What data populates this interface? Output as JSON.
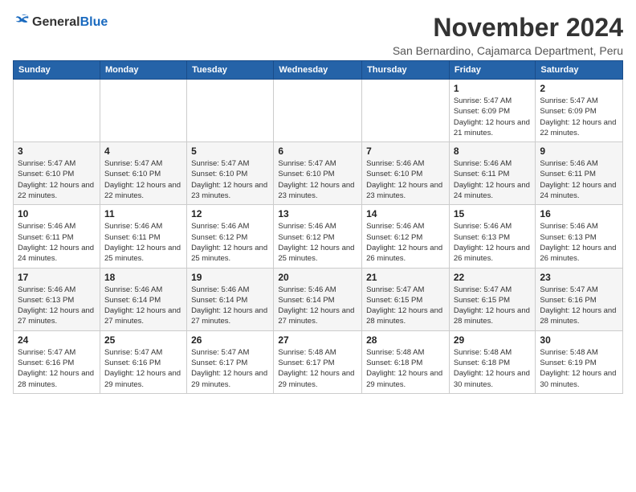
{
  "header": {
    "logo_general": "General",
    "logo_blue": "Blue",
    "month_title": "November 2024",
    "location": "San Bernardino, Cajamarca Department, Peru"
  },
  "weekdays": [
    "Sunday",
    "Monday",
    "Tuesday",
    "Wednesday",
    "Thursday",
    "Friday",
    "Saturday"
  ],
  "weeks": [
    [
      {
        "day": "",
        "info": ""
      },
      {
        "day": "",
        "info": ""
      },
      {
        "day": "",
        "info": ""
      },
      {
        "day": "",
        "info": ""
      },
      {
        "day": "",
        "info": ""
      },
      {
        "day": "1",
        "info": "Sunrise: 5:47 AM\nSunset: 6:09 PM\nDaylight: 12 hours and 21 minutes."
      },
      {
        "day": "2",
        "info": "Sunrise: 5:47 AM\nSunset: 6:09 PM\nDaylight: 12 hours and 22 minutes."
      }
    ],
    [
      {
        "day": "3",
        "info": "Sunrise: 5:47 AM\nSunset: 6:10 PM\nDaylight: 12 hours and 22 minutes."
      },
      {
        "day": "4",
        "info": "Sunrise: 5:47 AM\nSunset: 6:10 PM\nDaylight: 12 hours and 22 minutes."
      },
      {
        "day": "5",
        "info": "Sunrise: 5:47 AM\nSunset: 6:10 PM\nDaylight: 12 hours and 23 minutes."
      },
      {
        "day": "6",
        "info": "Sunrise: 5:47 AM\nSunset: 6:10 PM\nDaylight: 12 hours and 23 minutes."
      },
      {
        "day": "7",
        "info": "Sunrise: 5:46 AM\nSunset: 6:10 PM\nDaylight: 12 hours and 23 minutes."
      },
      {
        "day": "8",
        "info": "Sunrise: 5:46 AM\nSunset: 6:11 PM\nDaylight: 12 hours and 24 minutes."
      },
      {
        "day": "9",
        "info": "Sunrise: 5:46 AM\nSunset: 6:11 PM\nDaylight: 12 hours and 24 minutes."
      }
    ],
    [
      {
        "day": "10",
        "info": "Sunrise: 5:46 AM\nSunset: 6:11 PM\nDaylight: 12 hours and 24 minutes."
      },
      {
        "day": "11",
        "info": "Sunrise: 5:46 AM\nSunset: 6:11 PM\nDaylight: 12 hours and 25 minutes."
      },
      {
        "day": "12",
        "info": "Sunrise: 5:46 AM\nSunset: 6:12 PM\nDaylight: 12 hours and 25 minutes."
      },
      {
        "day": "13",
        "info": "Sunrise: 5:46 AM\nSunset: 6:12 PM\nDaylight: 12 hours and 25 minutes."
      },
      {
        "day": "14",
        "info": "Sunrise: 5:46 AM\nSunset: 6:12 PM\nDaylight: 12 hours and 26 minutes."
      },
      {
        "day": "15",
        "info": "Sunrise: 5:46 AM\nSunset: 6:13 PM\nDaylight: 12 hours and 26 minutes."
      },
      {
        "day": "16",
        "info": "Sunrise: 5:46 AM\nSunset: 6:13 PM\nDaylight: 12 hours and 26 minutes."
      }
    ],
    [
      {
        "day": "17",
        "info": "Sunrise: 5:46 AM\nSunset: 6:13 PM\nDaylight: 12 hours and 27 minutes."
      },
      {
        "day": "18",
        "info": "Sunrise: 5:46 AM\nSunset: 6:14 PM\nDaylight: 12 hours and 27 minutes."
      },
      {
        "day": "19",
        "info": "Sunrise: 5:46 AM\nSunset: 6:14 PM\nDaylight: 12 hours and 27 minutes."
      },
      {
        "day": "20",
        "info": "Sunrise: 5:46 AM\nSunset: 6:14 PM\nDaylight: 12 hours and 27 minutes."
      },
      {
        "day": "21",
        "info": "Sunrise: 5:47 AM\nSunset: 6:15 PM\nDaylight: 12 hours and 28 minutes."
      },
      {
        "day": "22",
        "info": "Sunrise: 5:47 AM\nSunset: 6:15 PM\nDaylight: 12 hours and 28 minutes."
      },
      {
        "day": "23",
        "info": "Sunrise: 5:47 AM\nSunset: 6:16 PM\nDaylight: 12 hours and 28 minutes."
      }
    ],
    [
      {
        "day": "24",
        "info": "Sunrise: 5:47 AM\nSunset: 6:16 PM\nDaylight: 12 hours and 28 minutes."
      },
      {
        "day": "25",
        "info": "Sunrise: 5:47 AM\nSunset: 6:16 PM\nDaylight: 12 hours and 29 minutes."
      },
      {
        "day": "26",
        "info": "Sunrise: 5:47 AM\nSunset: 6:17 PM\nDaylight: 12 hours and 29 minutes."
      },
      {
        "day": "27",
        "info": "Sunrise: 5:48 AM\nSunset: 6:17 PM\nDaylight: 12 hours and 29 minutes."
      },
      {
        "day": "28",
        "info": "Sunrise: 5:48 AM\nSunset: 6:18 PM\nDaylight: 12 hours and 29 minutes."
      },
      {
        "day": "29",
        "info": "Sunrise: 5:48 AM\nSunset: 6:18 PM\nDaylight: 12 hours and 30 minutes."
      },
      {
        "day": "30",
        "info": "Sunrise: 5:48 AM\nSunset: 6:19 PM\nDaylight: 12 hours and 30 minutes."
      }
    ]
  ]
}
